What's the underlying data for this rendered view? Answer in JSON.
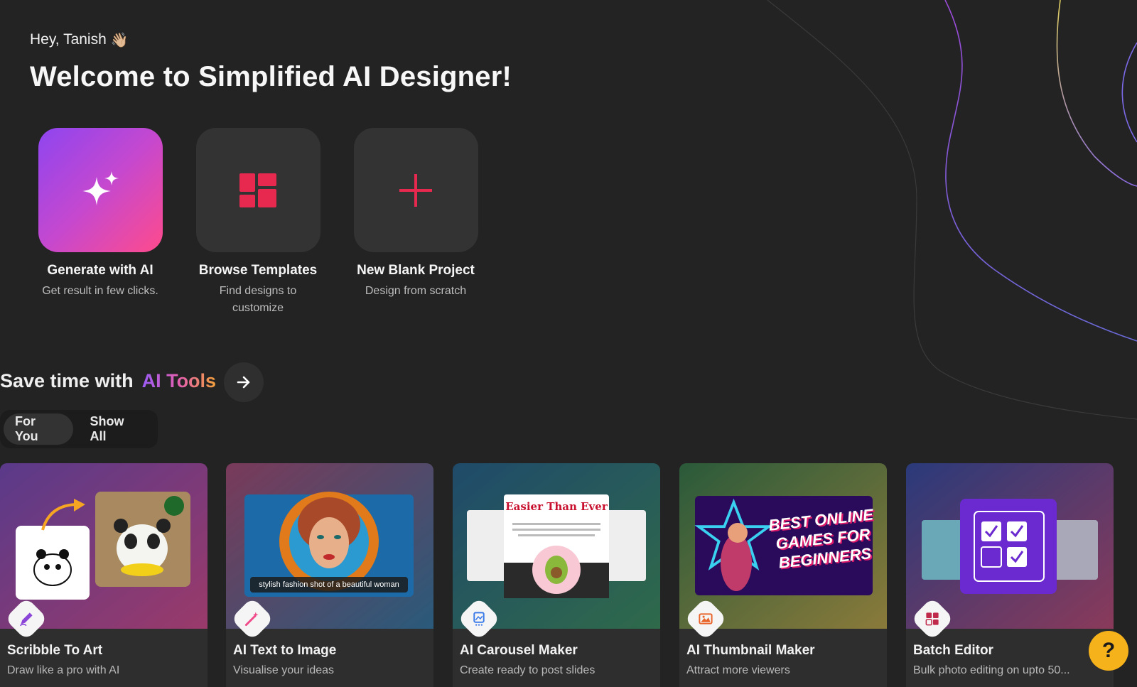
{
  "header": {
    "greeting": "Hey, Tanish",
    "wave": "👋🏼",
    "headline": "Welcome to Simplified AI Designer!"
  },
  "actions": [
    {
      "title": "Generate with AI",
      "subtitle": "Get result in few clicks.",
      "icon": "sparkles-icon"
    },
    {
      "title": "Browse Templates",
      "subtitle": "Find designs to customize",
      "icon": "templates-grid-icon"
    },
    {
      "title": "New Blank Project",
      "subtitle": "Design from scratch",
      "icon": "plus-icon"
    }
  ],
  "ai_tools": {
    "title_prefix": "Save time with",
    "title_highlight": "AI Tools",
    "tabs": [
      {
        "label": "For You",
        "active": true
      },
      {
        "label": "Show All",
        "active": false
      }
    ],
    "cards": [
      {
        "name": "Scribble To Art",
        "desc": "Draw like a pro with AI",
        "icon": "pencil-scribble-icon"
      },
      {
        "name": "AI Text to Image",
        "desc": "Visualise your ideas",
        "icon": "magic-wand-icon",
        "caption": "stylish fashion shot of a beautiful woman"
      },
      {
        "name": "AI Carousel Maker",
        "desc": "Create ready to post slides",
        "icon": "carousel-icon",
        "slide_title": "Easier Than Ever"
      },
      {
        "name": "AI Thumbnail Maker",
        "desc": "Attract more viewers",
        "icon": "thumbnail-image-icon",
        "thumb_text": "BEST ONLINE GAMES FOR BEGINNERS"
      },
      {
        "name": "Batch Editor",
        "desc": "Bulk photo editing on upto 50...",
        "icon": "batch-grid-icon"
      }
    ]
  },
  "help": {
    "label": "?"
  },
  "colors": {
    "background": "#232323",
    "accent_pink": "#e8294f",
    "gradient_start": "#8e45f0",
    "gradient_end": "#ff4b8c",
    "help_yellow": "#f6b21a"
  }
}
